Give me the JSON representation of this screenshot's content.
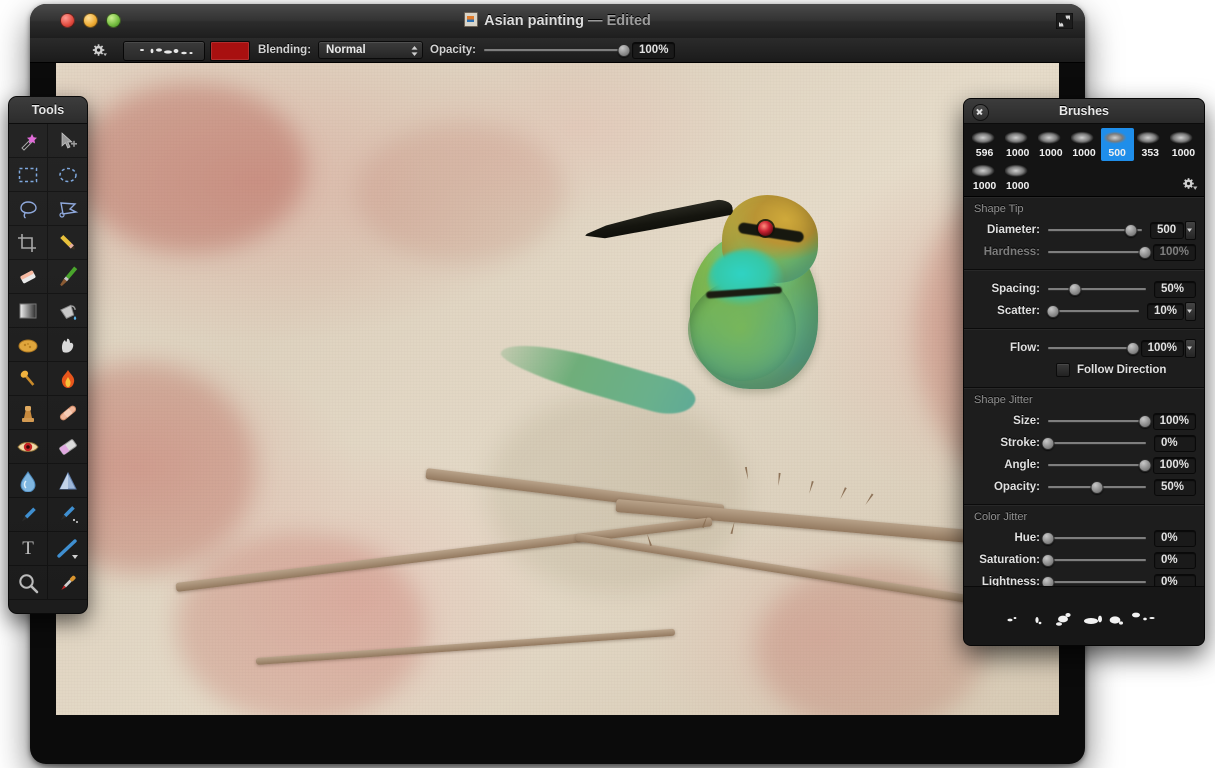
{
  "window": {
    "title": "Asian painting",
    "separator": "—",
    "state": "Edited",
    "doc_icon": "document-icon",
    "fullscreen_icon": "fullscreen-icon",
    "traffic_lights": [
      "close",
      "minimize",
      "zoom"
    ]
  },
  "toolbar": {
    "gear_icon": "gear-icon",
    "brush_preview_label": "brush-stroke-preview",
    "color_swatch": "#a81010",
    "blending_label": "Blending:",
    "blending_value": "Normal",
    "blending_options": [
      "Normal"
    ],
    "opacity_label": "Opacity:",
    "opacity_value": "100%",
    "opacity_percent": 100
  },
  "tools": {
    "title": "Tools",
    "items": [
      {
        "name": "magic-wand-tool",
        "glyph": "✨"
      },
      {
        "name": "move-tool",
        "glyph": "➤"
      },
      {
        "name": "rectangular-marquee-tool",
        "glyph": "▭"
      },
      {
        "name": "elliptical-marquee-tool",
        "glyph": "◯"
      },
      {
        "name": "lasso-tool",
        "glyph": "◌"
      },
      {
        "name": "polygonal-lasso-tool",
        "glyph": "◺"
      },
      {
        "name": "crop-tool",
        "glyph": "⌗"
      },
      {
        "name": "pencil-tool",
        "glyph": "✏"
      },
      {
        "name": "eraser-block-tool",
        "glyph": "🧽"
      },
      {
        "name": "paintbrush-tool",
        "glyph": "🖌"
      },
      {
        "name": "gradient-tool",
        "glyph": "▦"
      },
      {
        "name": "paint-bucket-tool",
        "glyph": "🪣"
      },
      {
        "name": "sponge-tool",
        "glyph": "🟠"
      },
      {
        "name": "smudge-tool",
        "glyph": "✋"
      },
      {
        "name": "dodge-tool",
        "glyph": "🔦"
      },
      {
        "name": "burn-tool",
        "glyph": "🔥"
      },
      {
        "name": "clone-stamp-tool",
        "glyph": "🏺"
      },
      {
        "name": "bandage-heal-tool",
        "glyph": "▬"
      },
      {
        "name": "red-eye-tool",
        "glyph": "👁"
      },
      {
        "name": "eraser-tool",
        "glyph": "🩹"
      },
      {
        "name": "blur-tool",
        "glyph": "💧"
      },
      {
        "name": "sharpen-tool",
        "glyph": "▲"
      },
      {
        "name": "pen-tool",
        "glyph": "🖊"
      },
      {
        "name": "freehand-pen-tool",
        "glyph": "🖋"
      },
      {
        "name": "text-tool",
        "glyph": "T"
      },
      {
        "name": "line-tool",
        "glyph": "╲"
      },
      {
        "name": "zoom-tool",
        "glyph": "🔍"
      },
      {
        "name": "eyedropper-tool",
        "glyph": "💉"
      }
    ]
  },
  "brushes_panel": {
    "title": "Brushes",
    "close_icon": "close-icon",
    "gear_icon": "gear-icon",
    "presets": [
      {
        "size": "596",
        "active": false
      },
      {
        "size": "1000",
        "active": false
      },
      {
        "size": "1000",
        "active": false
      },
      {
        "size": "1000",
        "active": false
      },
      {
        "size": "500",
        "active": true
      },
      {
        "size": "353",
        "active": false
      },
      {
        "size": "1000",
        "active": false
      },
      {
        "size": "1000",
        "active": false
      },
      {
        "size": "1000",
        "active": false
      }
    ],
    "sections": [
      {
        "heading": "Shape Tip",
        "rows": [
          {
            "label": "Diameter:",
            "value": "500",
            "percent": 88,
            "disabled": false,
            "stepper": true
          },
          {
            "label": "Hardness:",
            "value": "100%",
            "percent": 100,
            "disabled": true,
            "stepper": false
          }
        ]
      },
      {
        "heading": "",
        "rows": [
          {
            "label": "Spacing:",
            "value": "50%",
            "percent": 28,
            "disabled": false,
            "stepper": false
          },
          {
            "label": "Scatter:",
            "value": "10%",
            "percent": 6,
            "disabled": false,
            "stepper": true
          }
        ]
      },
      {
        "heading": "",
        "rows": [
          {
            "label": "Flow:",
            "value": "100%",
            "percent": 100,
            "disabled": false,
            "stepper": true
          }
        ],
        "checkbox": {
          "label": "Follow Direction",
          "checked": false
        }
      },
      {
        "heading": "Shape Jitter",
        "rows": [
          {
            "label": "Size:",
            "value": "100%",
            "percent": 100,
            "disabled": false,
            "stepper": false
          },
          {
            "label": "Stroke:",
            "value": "0%",
            "percent": 0,
            "disabled": false,
            "stepper": false
          },
          {
            "label": "Angle:",
            "value": "100%",
            "percent": 100,
            "disabled": false,
            "stepper": false
          },
          {
            "label": "Opacity:",
            "value": "50%",
            "percent": 50,
            "disabled": false,
            "stepper": false
          }
        ]
      },
      {
        "heading": "Color Jitter",
        "rows": [
          {
            "label": "Hue:",
            "value": "0%",
            "percent": 0,
            "disabled": false,
            "stepper": false
          },
          {
            "label": "Saturation:",
            "value": "0%",
            "percent": 0,
            "disabled": false,
            "stepper": false
          },
          {
            "label": "Lightness:",
            "value": "0%",
            "percent": 0,
            "disabled": false,
            "stepper": false
          }
        ]
      }
    ],
    "stroke_preview_label": "brush-stroke-preview"
  },
  "canvas": {
    "artwork_name": "green-bee-eater-watercolor",
    "background_color": "#e0d5c2"
  }
}
